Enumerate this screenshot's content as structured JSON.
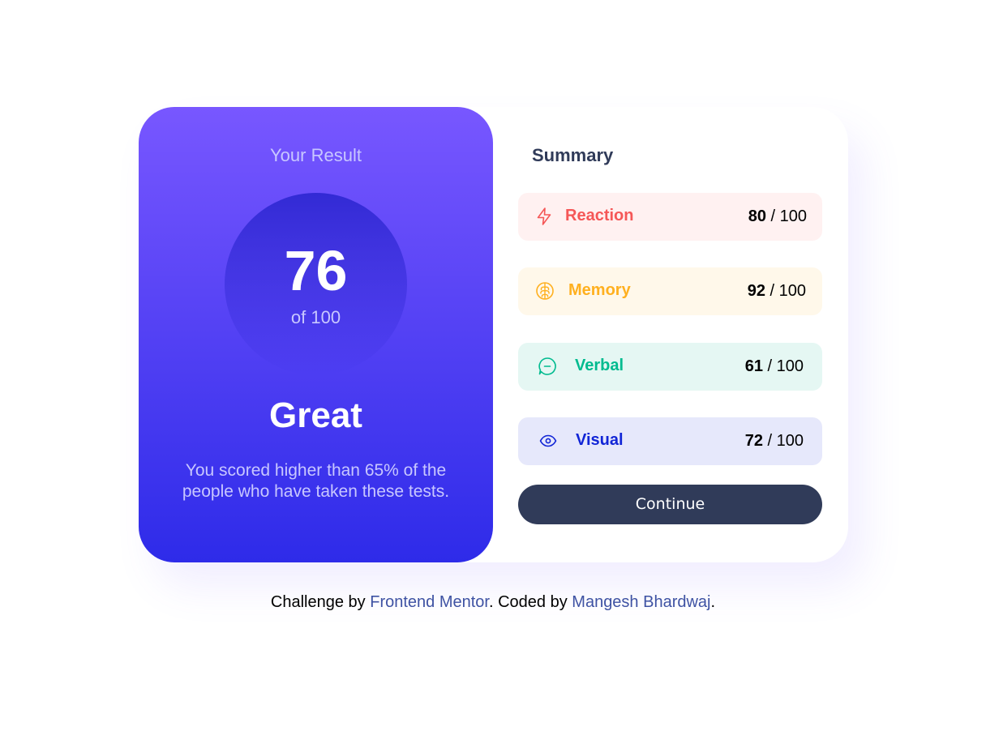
{
  "result": {
    "title": "Your Result",
    "score": "76",
    "score_of": "of 100",
    "rating": "Great",
    "description": "You scored higher than 65% of the people who have taken these tests."
  },
  "summary": {
    "title": "Summary",
    "items": [
      {
        "label": "Reaction",
        "score": "80",
        "out_of": " / 100",
        "icon": "lightning-icon",
        "color": "#f55757",
        "bg": "#fff1f1"
      },
      {
        "label": "Memory",
        "score": "92",
        "out_of": " / 100",
        "icon": "brain-icon",
        "color": "#ffb01f",
        "bg": "#fff8ea"
      },
      {
        "label": "Verbal",
        "score": "61",
        "out_of": " / 100",
        "icon": "speech-bubble-icon",
        "color": "#00bb8f",
        "bg": "#e5f7f3"
      },
      {
        "label": "Visual",
        "score": "72",
        "out_of": " / 100",
        "icon": "eye-icon",
        "color": "#1125d6",
        "bg": "#e6e8fb"
      }
    ],
    "continue_label": "Continue"
  },
  "attribution": {
    "prefix": "Challenge by ",
    "link1": "Frontend Mentor",
    "middle": ". Coded by ",
    "link2": "Mangesh Bhardwaj",
    "suffix": "."
  }
}
